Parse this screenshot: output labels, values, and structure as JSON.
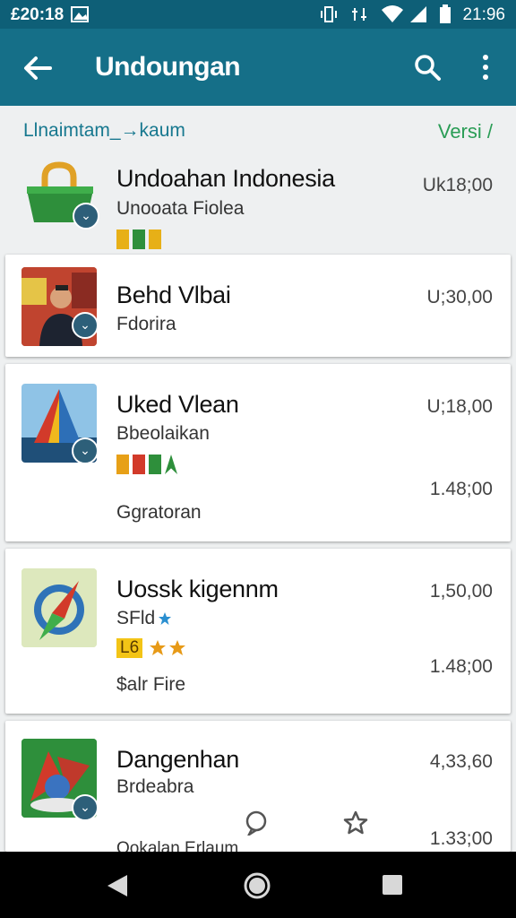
{
  "status_bar": {
    "left_text": "£20:18",
    "time": "21:96"
  },
  "app_bar": {
    "title": "Undoungan"
  },
  "subheader": {
    "label": "Llnaimtam_→kaum",
    "version": "Versi /"
  },
  "items": [
    {
      "name": "Undoahan Indonesia",
      "subtitle": "Unooata Fiolea",
      "size": "Uk18;00"
    },
    {
      "name": "Behd Vlbai",
      "subtitle": "Fdorira",
      "size": "U;30,00"
    },
    {
      "name": "Uked Vlean",
      "subtitle": "Bbeolaikan",
      "size": "U;18,00",
      "size2": "1.48;00",
      "extra": "Ggratoran"
    },
    {
      "name": "Uossk kigennm",
      "subtitle": "SFld",
      "size": "1,50,00",
      "size2": "1.48;00",
      "extra": "$alr Fire",
      "rating_label": "L6"
    },
    {
      "name": "Dangenhan",
      "subtitle": "Brdeabra",
      "size": "4,33,60",
      "size2": "1.33;00",
      "extra": "Ookalan Erlaum"
    }
  ],
  "colors": {
    "appbar": "#156f88",
    "statusbar": "#0e5f77",
    "accent": "#17788f",
    "version": "#2a9d56"
  }
}
